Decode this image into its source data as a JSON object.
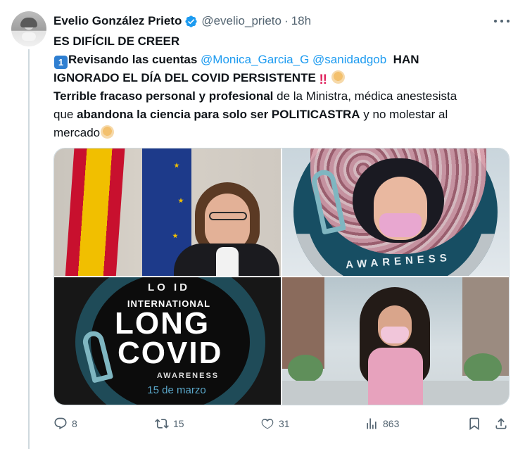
{
  "tweet": {
    "author_name": "Evelio González Prieto",
    "handle": "@evelio_prieto",
    "separator": "·",
    "time": "18h",
    "lines": {
      "l1": "ES DIFÍCIL DE CREER",
      "l2_bold": "Revisando las cuentas",
      "mention1": "@Monica_Garcia_G",
      "mention2": "@sanidadgob",
      "l2_tail": "HAN",
      "l3_bold": "IGNORADO EL DÍA DEL COVID PERSISTENTE",
      "l4_bold": "Terrible fracaso personal y profesional",
      "l4_rest": " de la Ministra, médica anestesista",
      "l5_pre": "que ",
      "l5_bold1": "abandona la ciencia para solo ser POLITICASTRA",
      "l5_rest": " y no molestar al",
      "l6": "mercado"
    },
    "keycap_number": "1",
    "bang_glyph": "‼",
    "media": {
      "image3": {
        "ring_text": "LO    ID",
        "line1": "INTERNATIONAL",
        "line2": "LONG",
        "line3": "COVID",
        "line4": "AWARENESS",
        "date": "15 de marzo"
      },
      "image2": {
        "awareness": "AWARENESS"
      }
    },
    "stats": {
      "replies": "8",
      "reposts": "15",
      "likes": "31",
      "views": "863"
    }
  },
  "colors": {
    "link": "#1d9bf0",
    "text": "#0f1419",
    "muted": "#536471",
    "verified": "#1d9bf0"
  },
  "icons": [
    "avatar",
    "verified-icon",
    "more-icon",
    "reply-icon",
    "repost-icon",
    "like-icon",
    "views-icon",
    "bookmark-icon",
    "share-icon"
  ]
}
